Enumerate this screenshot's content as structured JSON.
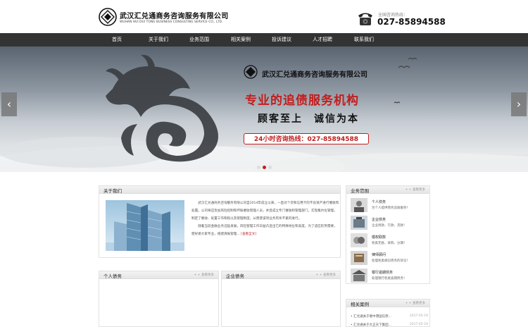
{
  "header": {
    "company_cn": "武汉汇兑通商务咨询服务有限公司",
    "company_en": "WUHAN HUI DUI TONG BUSINESS CONSULTING SERVICE CO., LTD.",
    "hotline_label": "全国咨询热线：",
    "hotline_number": "027-85894588"
  },
  "nav": {
    "items": [
      "首页",
      "关于我们",
      "业务范围",
      "相关案例",
      "投诉建议",
      "人才招聘",
      "联系我们"
    ]
  },
  "banner": {
    "company": "武汉汇兑通商务咨询服务有限公司",
    "slogan": "专业的追债服务机构",
    "tagline": "顾客至上　诚信为本",
    "hotline": "24小时咨询热线：027-85894588",
    "prev_arrow": "‹",
    "next_arrow": "›",
    "active_slide": 2,
    "slide_count": 3
  },
  "about": {
    "title": "关于我们",
    "more": "+ + 查看更多",
    "text_p1": "　　武汉汇兑通商务咨询服务有限公司自2014年成立以来，一直对个贷和信用卡的不良资产进行催收和处置。公司将应急加风险控制和坏账催收管理人员，并且成立专门催收和管理部门，实现集约化管理，制定了催收、处置工作和程以及管理制度，从而使该项业务有条不紊的进行。",
    "text_p2": "　　随着当前金融业务迅猛发展，风险管理工作日益凸显出它的特殊地位和高度，为了适应形势需要，使好委大家专业，络建清账管理...",
    "read_more": "[查看全文]"
  },
  "personal": {
    "title": "个人债务",
    "more": "+ + 查看更多"
  },
  "corporate": {
    "title": "企业债务",
    "more": "+ + 查看更多"
  },
  "scope": {
    "title": "业务范围",
    "more": "+ + 查看更多",
    "items": [
      {
        "name": "个人债务",
        "desc": "为个人提供债务追收服务！"
      },
      {
        "name": "企业债务",
        "desc": "企业周款、欠款、货款！"
      },
      {
        "name": "婚权取款",
        "desc": "各类无抵、采购、分期！"
      },
      {
        "name": "律师顾问",
        "desc": "处理各类规讼债务的诉讼！"
      },
      {
        "name": "银行逾期债务",
        "desc": "处理银行各类逾期债务！"
      }
    ]
  },
  "cases": {
    "title": "相关案例",
    "more": "+ + 查看更多",
    "items": [
      {
        "text": "• 汇兑通关于催中港国信债...",
        "date": "2017-05-19"
      },
      {
        "text": "• 汇兑通关于大正天下集团...",
        "date": "2017-05-19"
      }
    ]
  }
}
